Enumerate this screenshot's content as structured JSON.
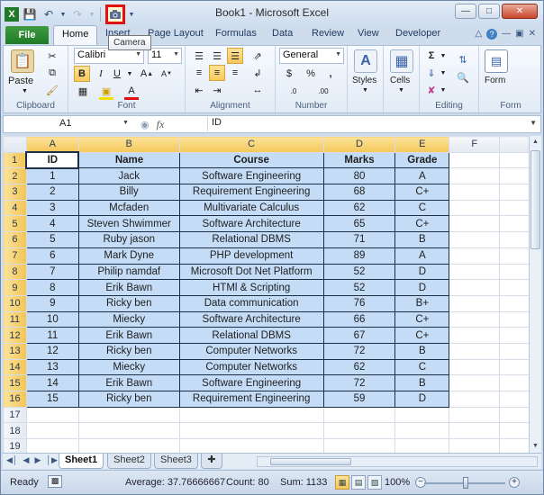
{
  "window": {
    "title": "Book1  -  Microsoft Excel"
  },
  "qat": {
    "camera_tooltip": "Camera"
  },
  "tabs": [
    "File",
    "Home",
    "Insert",
    "Page Layout",
    "Formulas",
    "Data",
    "Review",
    "View",
    "Developer"
  ],
  "ribbon": {
    "clipboard": {
      "label": "Clipboard",
      "paste": "Paste"
    },
    "font": {
      "label": "Font",
      "name": "Calibri",
      "size": "11",
      "bold": "B",
      "italic": "I",
      "underline": "U"
    },
    "alignment": {
      "label": "Alignment"
    },
    "number": {
      "label": "Number",
      "format": "General",
      "currency": "$",
      "percent": "%",
      "comma": ",",
      "inc_decimal": ".0",
      "dec_decimal": ".00"
    },
    "styles": {
      "label": "Styles"
    },
    "cells": {
      "label": "Cells"
    },
    "editing": {
      "label": "Editing"
    },
    "form": {
      "label": "Form",
      "button": "Form"
    }
  },
  "formula_bar": {
    "name_box": "A1",
    "fx": "fx",
    "content": "ID"
  },
  "columns": [
    "A",
    "B",
    "C",
    "D",
    "E",
    "F"
  ],
  "rows": [
    "1",
    "2",
    "3",
    "4",
    "5",
    "6",
    "7",
    "8",
    "9",
    "10",
    "11",
    "12",
    "13",
    "14",
    "15",
    "16",
    "17",
    "18",
    "19"
  ],
  "table": {
    "headers": [
      "ID",
      "Name",
      "Course",
      "Marks",
      "Grade"
    ],
    "rows": [
      [
        "1",
        "Jack",
        "Software Engineering",
        "80",
        "A"
      ],
      [
        "2",
        "Billy",
        "Requirement Engineering",
        "68",
        "C+"
      ],
      [
        "3",
        "Mcfaden",
        "Multivariate Calculus",
        "62",
        "C"
      ],
      [
        "4",
        "Steven Shwimmer",
        "Software Architecture",
        "65",
        "C+"
      ],
      [
        "5",
        "Ruby jason",
        "Relational DBMS",
        "71",
        "B"
      ],
      [
        "6",
        "Mark Dyne",
        "PHP development",
        "89",
        "A"
      ],
      [
        "7",
        "Philip namdaf",
        "Microsoft Dot Net Platform",
        "52",
        "D"
      ],
      [
        "8",
        "Erik Bawn",
        "HTMl & Scripting",
        "52",
        "D"
      ],
      [
        "9",
        "Ricky ben",
        "Data communication",
        "76",
        "B+"
      ],
      [
        "10",
        "Miecky",
        "Software Architecture",
        "66",
        "C+"
      ],
      [
        "11",
        "Erik Bawn",
        "Relational DBMS",
        "67",
        "C+"
      ],
      [
        "12",
        "Ricky ben",
        "Computer Networks",
        "72",
        "B"
      ],
      [
        "13",
        "Miecky",
        "Computer Networks",
        "62",
        "C"
      ],
      [
        "14",
        "Erik Bawn",
        "Software Engineering",
        "72",
        "B"
      ],
      [
        "15",
        "Ricky ben",
        "Requirement Engineering",
        "59",
        "D"
      ]
    ]
  },
  "sheets": [
    "Sheet1",
    "Sheet2",
    "Sheet3"
  ],
  "status": {
    "ready": "Ready",
    "average": "Average: 37.76666667",
    "count": "Count: 80",
    "sum": "Sum: 1133",
    "zoom": "100%"
  },
  "colors": {
    "selection_fill": "#c5dcf7",
    "file_tab": "#1f7a27",
    "highlight": "#f7c95a"
  }
}
